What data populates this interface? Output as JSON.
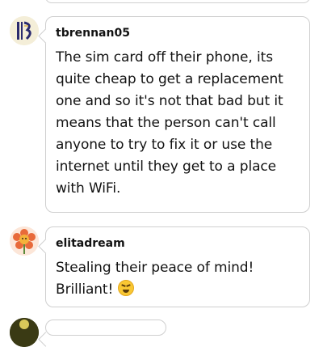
{
  "comments": [
    {
      "username": "tbrennan05",
      "text": "The sim card off their phone, its quite cheap to get a replacement one and so it's not that bad but it means that the person can't call anyone to try to fix it or use the internet until they get to a place with WiFi."
    },
    {
      "username": "elitadream",
      "text": "Stealing their peace of mind! Brilliant!",
      "emoji": "laughing-squint-emoji"
    }
  ],
  "colors": {
    "border": "#cfcfcf",
    "text": "#121212",
    "emoji": "#f9c733"
  }
}
